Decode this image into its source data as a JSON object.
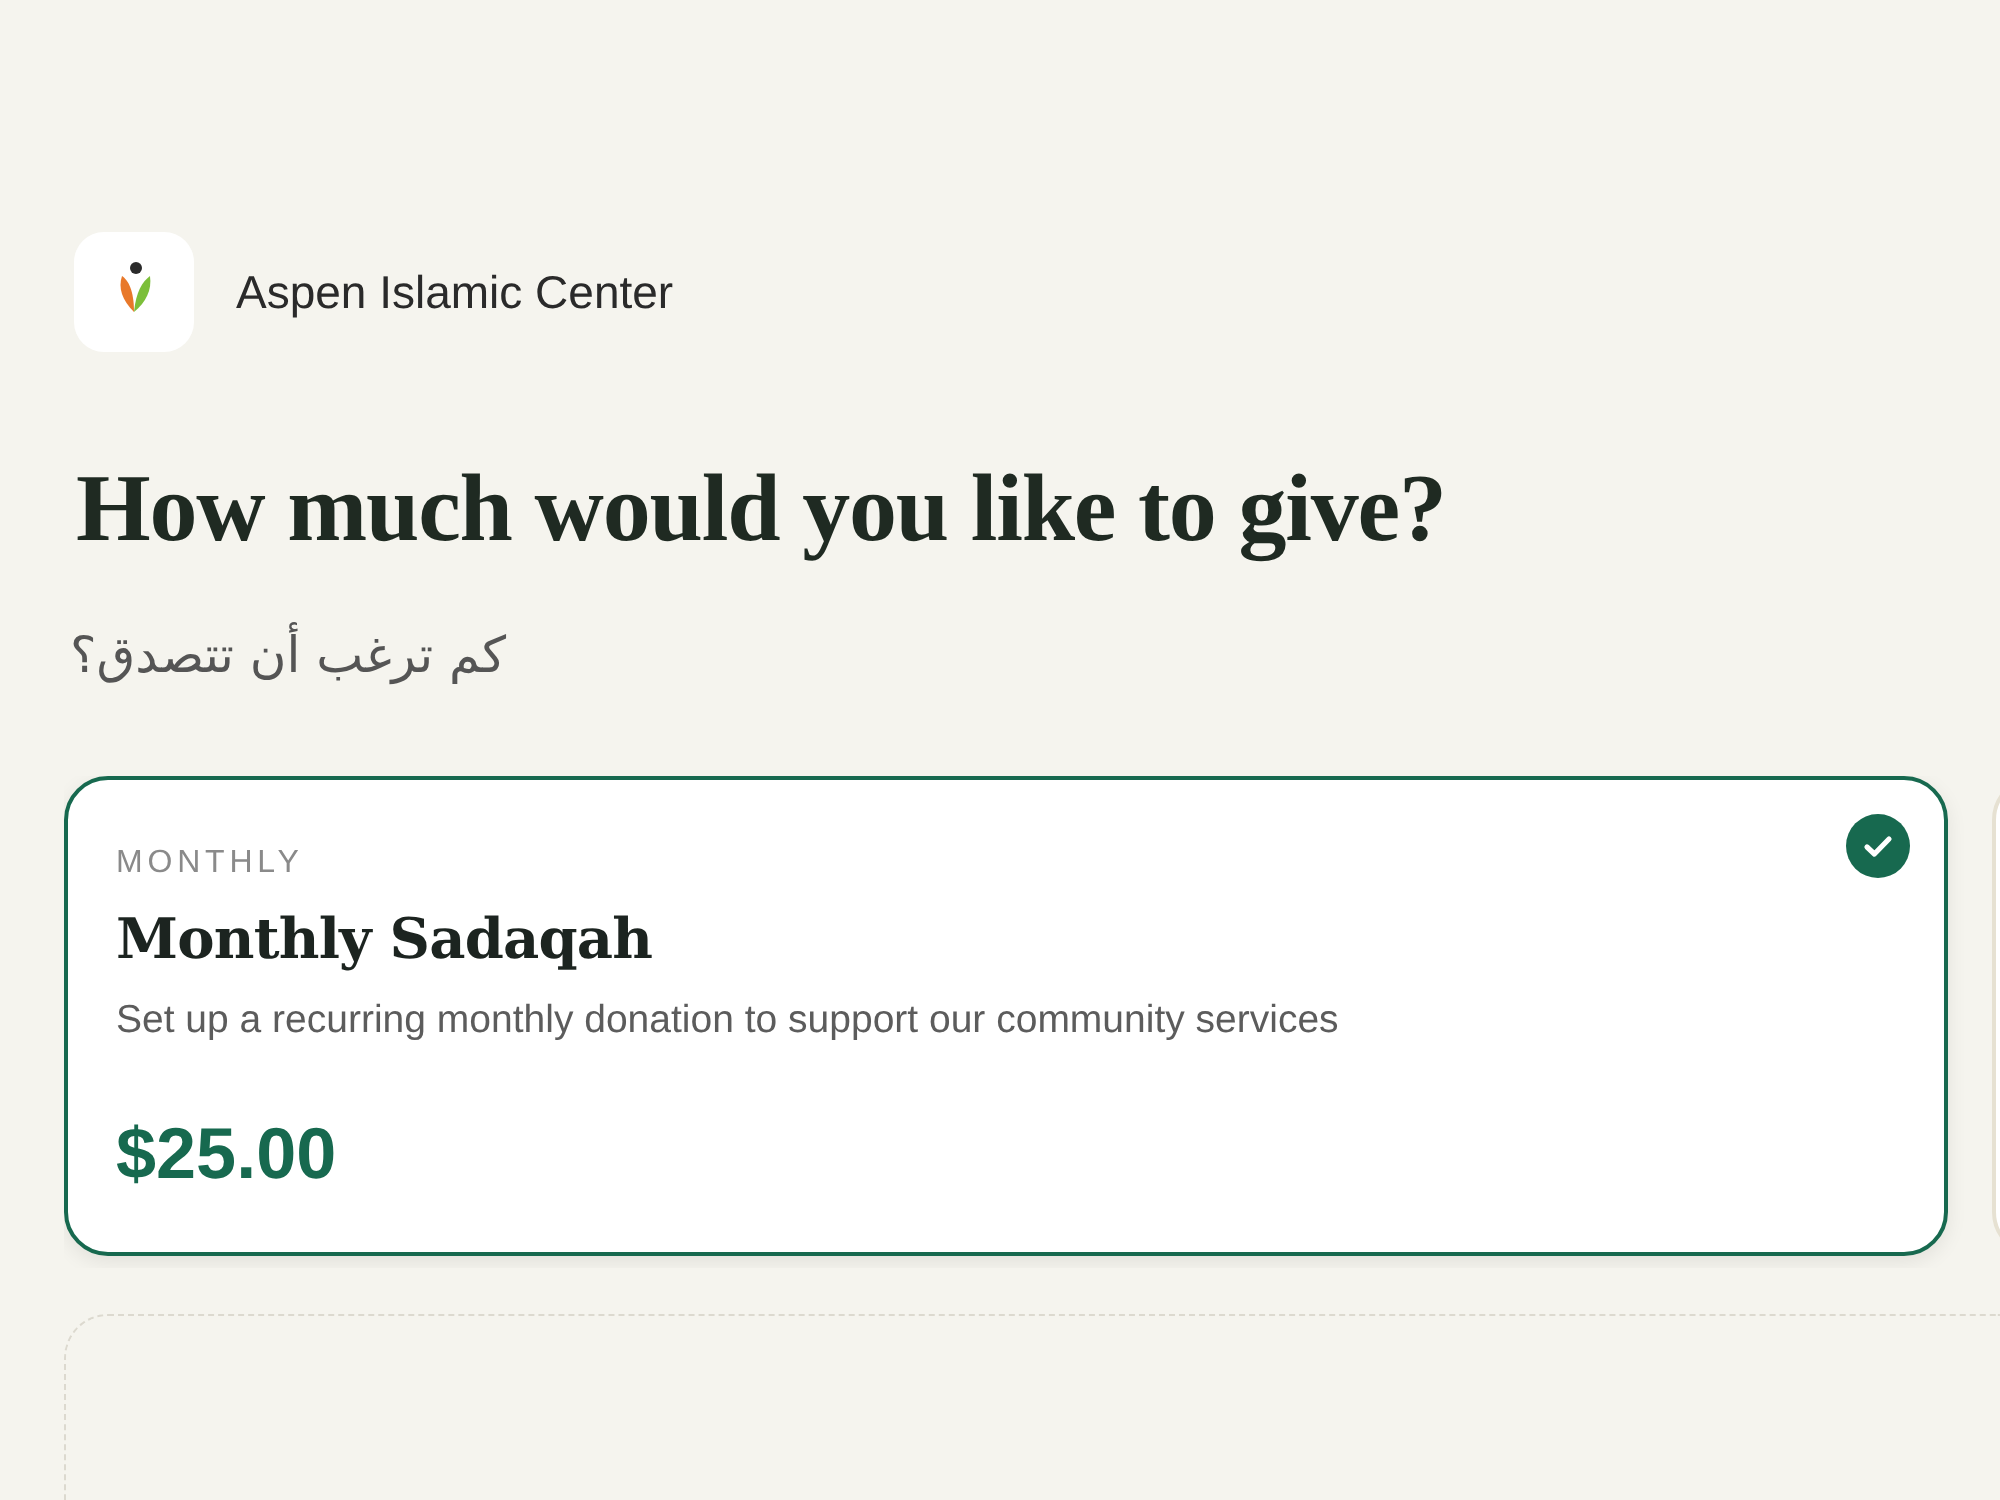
{
  "organization": {
    "name": "Aspen Islamic Center"
  },
  "heading": "How much would you like to give?",
  "subheading": "كم ترغب أن تتصدق؟",
  "options": [
    {
      "frequency": "MONTHLY",
      "title": "Monthly Sadaqah",
      "description": "Set up a recurring monthly donation to support our community services",
      "amount": "$25.00",
      "selected": true
    },
    {
      "selected": false
    }
  ]
}
